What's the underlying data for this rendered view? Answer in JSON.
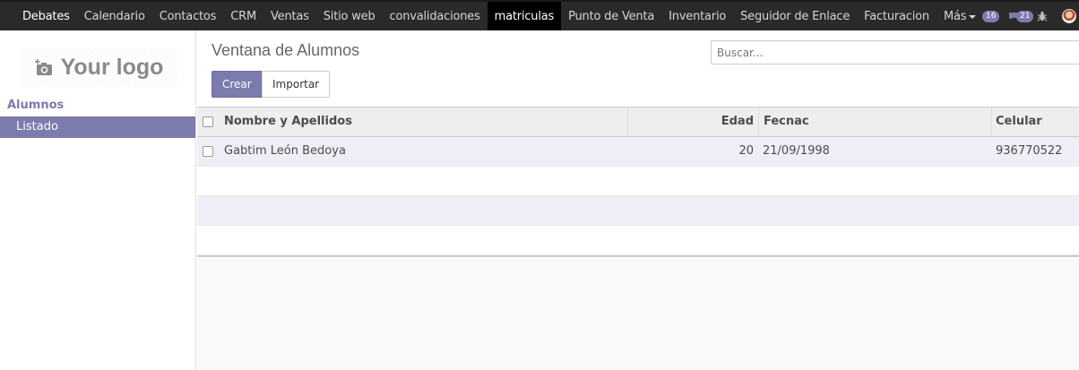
{
  "menu": [
    "Debates",
    "Calendario",
    "Contactos",
    "CRM",
    "Ventas",
    "Sitio web",
    "convalidaciones",
    "matriculas",
    "Punto de Venta",
    "Inventario",
    "Seguidor de Enlace",
    "Facturacion",
    "Más"
  ],
  "menu_active": "matriculas",
  "systray": {
    "messages_count": "16",
    "chat_count": "21"
  },
  "sidebar": {
    "logo_text": "Your logo",
    "section": "Alumnos",
    "item": "Listado"
  },
  "control": {
    "breadcrumb": "Ventana de Alumnos",
    "create_label": "Crear",
    "import_label": "Importar",
    "search_placeholder": "Buscar..."
  },
  "table": {
    "columns": [
      "Nombre y Apellidos",
      "Edad",
      "Fecnac",
      "Celular"
    ],
    "rows": [
      {
        "name": "Gabtim León Bedoya",
        "edad": "20",
        "fecnac": "21/09/1998",
        "celular": "936770522"
      }
    ]
  },
  "colors": {
    "accent": "#7c7bad",
    "navbar": "#2a2a2a",
    "active_menu": "#000000"
  }
}
